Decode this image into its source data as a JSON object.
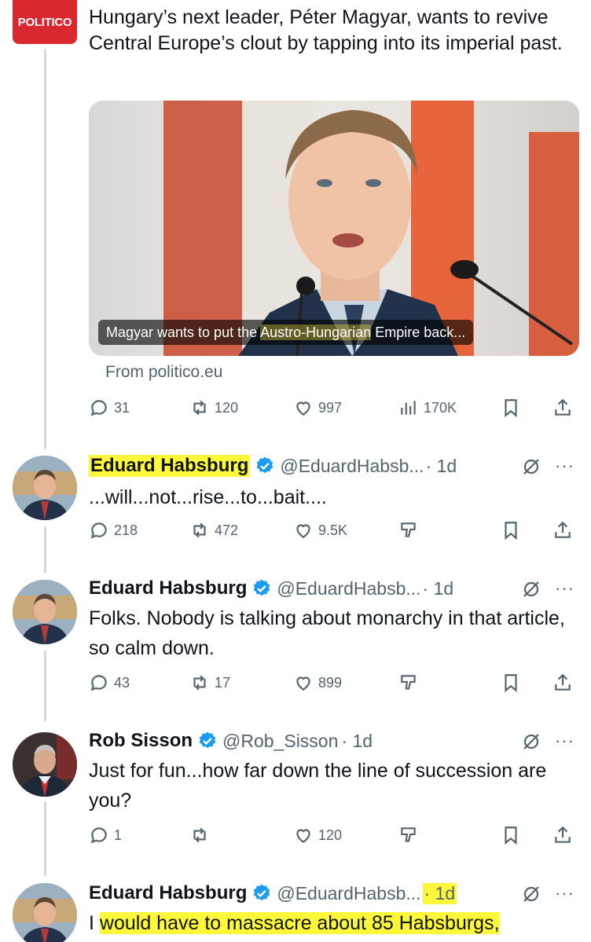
{
  "politico_post": {
    "logo_text": "POLITICO",
    "text": "Hungary’s next leader, Péter Magyar, wants to revive Central Europe’s clout by tapping into its imperial past.",
    "card": {
      "caption_before": "Magyar wants to put the ",
      "caption_highlight": "Austro-Hungarian",
      "caption_after": " Empire back...",
      "source": "From politico.eu"
    },
    "stats": {
      "replies": "31",
      "reposts": "120",
      "likes": "997",
      "views": "170K"
    }
  },
  "replies": [
    {
      "name": "Eduard Habsburg",
      "handle": "@EduardHabsb...",
      "time": "· 1d",
      "text": "...will...not...rise...to...bait....",
      "stats": {
        "replies": "218",
        "reposts": "472",
        "likes": "9.5K"
      }
    },
    {
      "name": "Eduard Habsburg",
      "handle": "@EduardHabsb...",
      "time": "· 1d",
      "text": "Folks. Nobody is talking about monarchy in that article, so calm down.",
      "stats": {
        "replies": "43",
        "reposts": "17",
        "likes": "899"
      }
    },
    {
      "name": "Rob Sisson",
      "handle": "@Rob_Sisson",
      "time": "· 1d",
      "text": "Just for fun...how far down the line of succession are you?",
      "stats": {
        "replies": "1",
        "reposts": "",
        "likes": "120"
      }
    },
    {
      "name": "Eduard Habsburg",
      "handle": "@EduardHabsb...",
      "time": "· 1d",
      "text_before": "I ",
      "text_highlight": "would have to massacre about 85 Habsburgs,"
    }
  ],
  "icons": {
    "reply": "reply-icon",
    "repost": "repost-icon",
    "like": "heart-icon",
    "views": "views-chart-icon",
    "bookmark": "bookmark-icon",
    "share": "share-icon",
    "downvote": "downvote-icon",
    "grok": "grok-icon",
    "more": "more-icon",
    "verified": "verified-badge-icon"
  },
  "colors": {
    "accent": "#1d9bf0",
    "politico_red": "#d9282f",
    "highlight": "#fff73a",
    "secondary_text": "#536471"
  }
}
